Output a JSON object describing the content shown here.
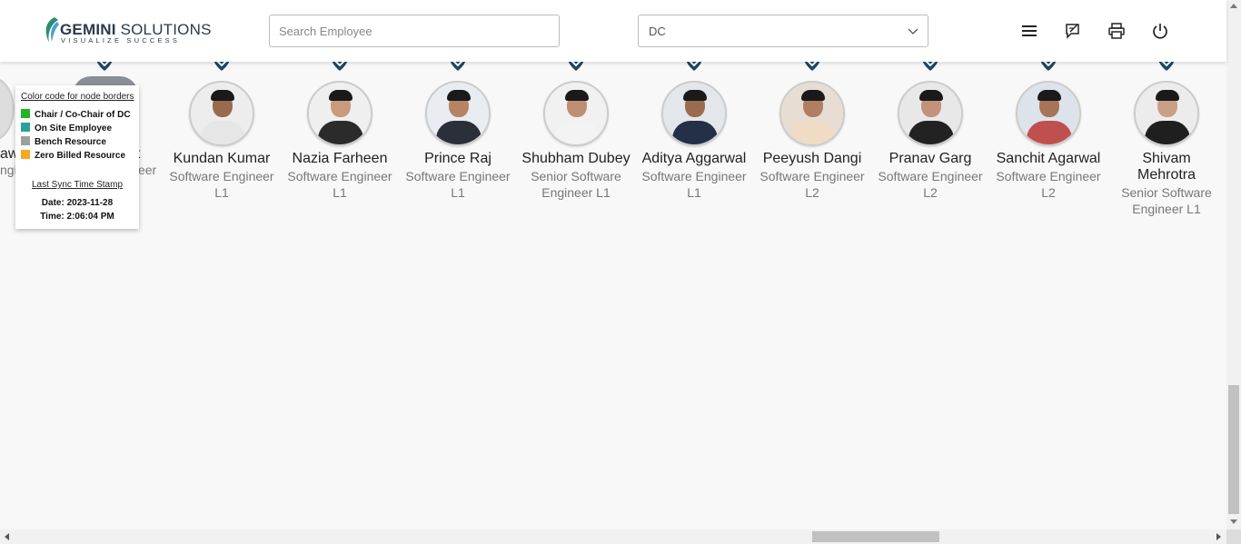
{
  "header": {
    "logo_name_bold": "GEMINI",
    "logo_name_rest": " SOLUTIONS",
    "logo_tagline": "VISUALIZE SUCCESS",
    "search_placeholder": "Search Employee",
    "dc_select_value": "DC"
  },
  "legend": {
    "title": "Color code for node borders",
    "items": [
      {
        "label": "Chair / Co-Chair of DC",
        "color": "#22b422"
      },
      {
        "label": "On Site Employee",
        "color": "#2aa198"
      },
      {
        "label": "Bench Resource",
        "color": "#9e9e9e"
      },
      {
        "label": "Zero Billed Resource",
        "color": "#f5a623"
      }
    ],
    "sync_title": "Last Sync Time Stamp",
    "sync_date": "Date: 2023-11-28",
    "sync_time": "Time: 2:06:04 PM"
  },
  "partial_left": {
    "name1": "aw",
    "role1": "ngineer",
    "name2": "nt",
    "role2": "Software Engineer"
  },
  "employees": [
    {
      "name": "Kundan Kumar",
      "role_line1": "Software Engineer",
      "role_line2": "L1"
    },
    {
      "name": "Nazia Farheen",
      "role_line1": "Software Engineer",
      "role_line2": "L1"
    },
    {
      "name": "Prince Raj",
      "role_line1": "Software Engineer",
      "role_line2": "L1"
    },
    {
      "name": "Shubham Dubey",
      "role_line1": "Senior Software",
      "role_line2": "Engineer L1"
    },
    {
      "name": "Aditya Aggarwal",
      "role_line1": "Software Engineer",
      "role_line2": "L1"
    },
    {
      "name": "Peeyush Dangi",
      "role_line1": "Software Engineer",
      "role_line2": "L2"
    },
    {
      "name": "Pranav Garg",
      "role_line1": "Software Engineer",
      "role_line2": "L2"
    },
    {
      "name": "Sanchit Agarwal",
      "role_line1": "Software Engineer",
      "role_line2": "L2"
    },
    {
      "name": "Shivam Mehrotra",
      "role_line1": "Senior Software",
      "role_line2": "Engineer L1"
    }
  ],
  "icons": [
    "hamburger-menu-icon",
    "feedback-icon",
    "printer-icon",
    "power-icon",
    "chevron-down-icon"
  ]
}
